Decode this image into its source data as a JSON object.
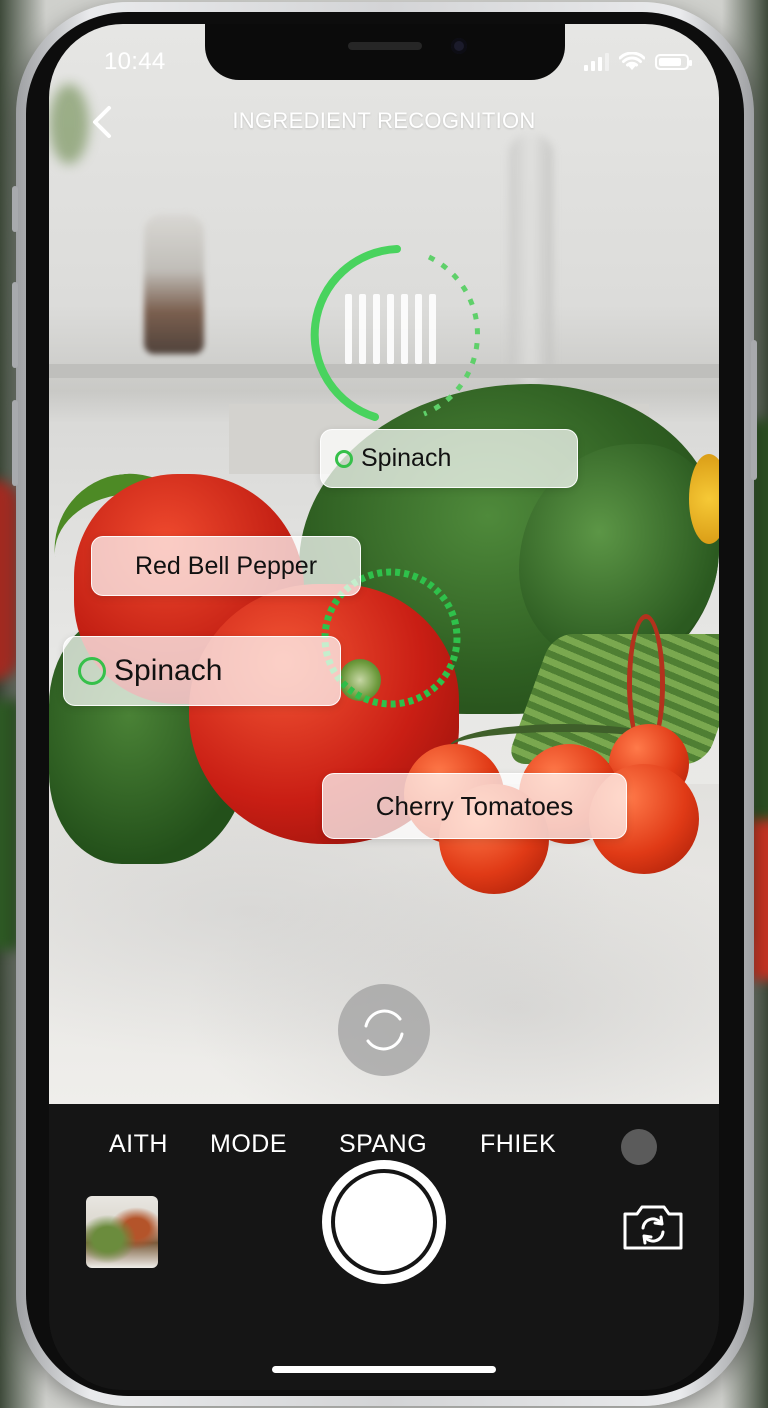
{
  "status_bar": {
    "time": "10:44"
  },
  "header": {
    "title": "INGREDIENT RECOGNITION",
    "back_icon": "chevron-left-icon"
  },
  "detections": [
    {
      "label": "Spinach",
      "indicator": true
    },
    {
      "label": "Red Bell Pepper",
      "indicator": false
    },
    {
      "label": "Spinach",
      "indicator": true
    },
    {
      "label": "Cherry Tomatoes",
      "indicator": false
    }
  ],
  "modes": [
    "AITH",
    "MODE",
    "SPANG",
    "FHIEK"
  ],
  "controls": {
    "gallery_icon": "gallery-thumbnail-icon",
    "shutter_icon": "shutter-icon",
    "flip_icon": "flip-camera-icon"
  },
  "colors": {
    "accent_green": "#36c04a",
    "background": "#151515",
    "tag_background": "rgba(255,255,255,0.72)"
  }
}
